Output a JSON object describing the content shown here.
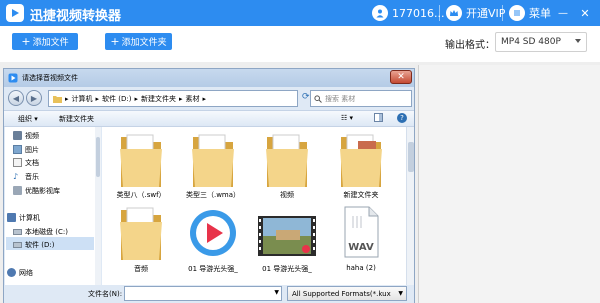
{
  "app": {
    "title": "迅捷视频转换器",
    "account": "177016...",
    "vip": "开通VIP",
    "menu": "菜单",
    "minimize": "—",
    "close": "✕"
  },
  "toolbar": {
    "add_file": "添加文件",
    "add_folder": "添加文件夹",
    "output_label": "输出格式：",
    "output_value": "MP4  SD 480P"
  },
  "dialog": {
    "title": "请选择音视频文件",
    "close": "✕",
    "path": [
      "计算机",
      "软件 (D:)",
      "新建文件夹",
      "素材"
    ],
    "search_placeholder": "搜索 素材",
    "organize": "组织 ▾",
    "new_folder": "新建文件夹",
    "nav_items": [
      "视频",
      "图片",
      "文档",
      "音乐",
      "优酷影视库",
      "计算机",
      "本地磁盘 (C:)",
      "软件 (D:)",
      "网络"
    ],
    "files": [
      {
        "name": "类型八（.swf）",
        "type": "folder"
      },
      {
        "name": "类型三（.wma）",
        "type": "folder"
      },
      {
        "name": "视频",
        "type": "folder"
      },
      {
        "name": "新建文件夹",
        "type": "folder"
      },
      {
        "name": "音频",
        "type": "folder"
      },
      {
        "name": "01 导游光头强_",
        "type": "video-app"
      },
      {
        "name": "01 导游光头强_",
        "type": "video-thumb"
      },
      {
        "name": "haha (2)",
        "type": "wav"
      }
    ],
    "filename_label": "文件名(N):",
    "filename_value": "",
    "filetype": "All Supported Formats(*.kux"
  }
}
